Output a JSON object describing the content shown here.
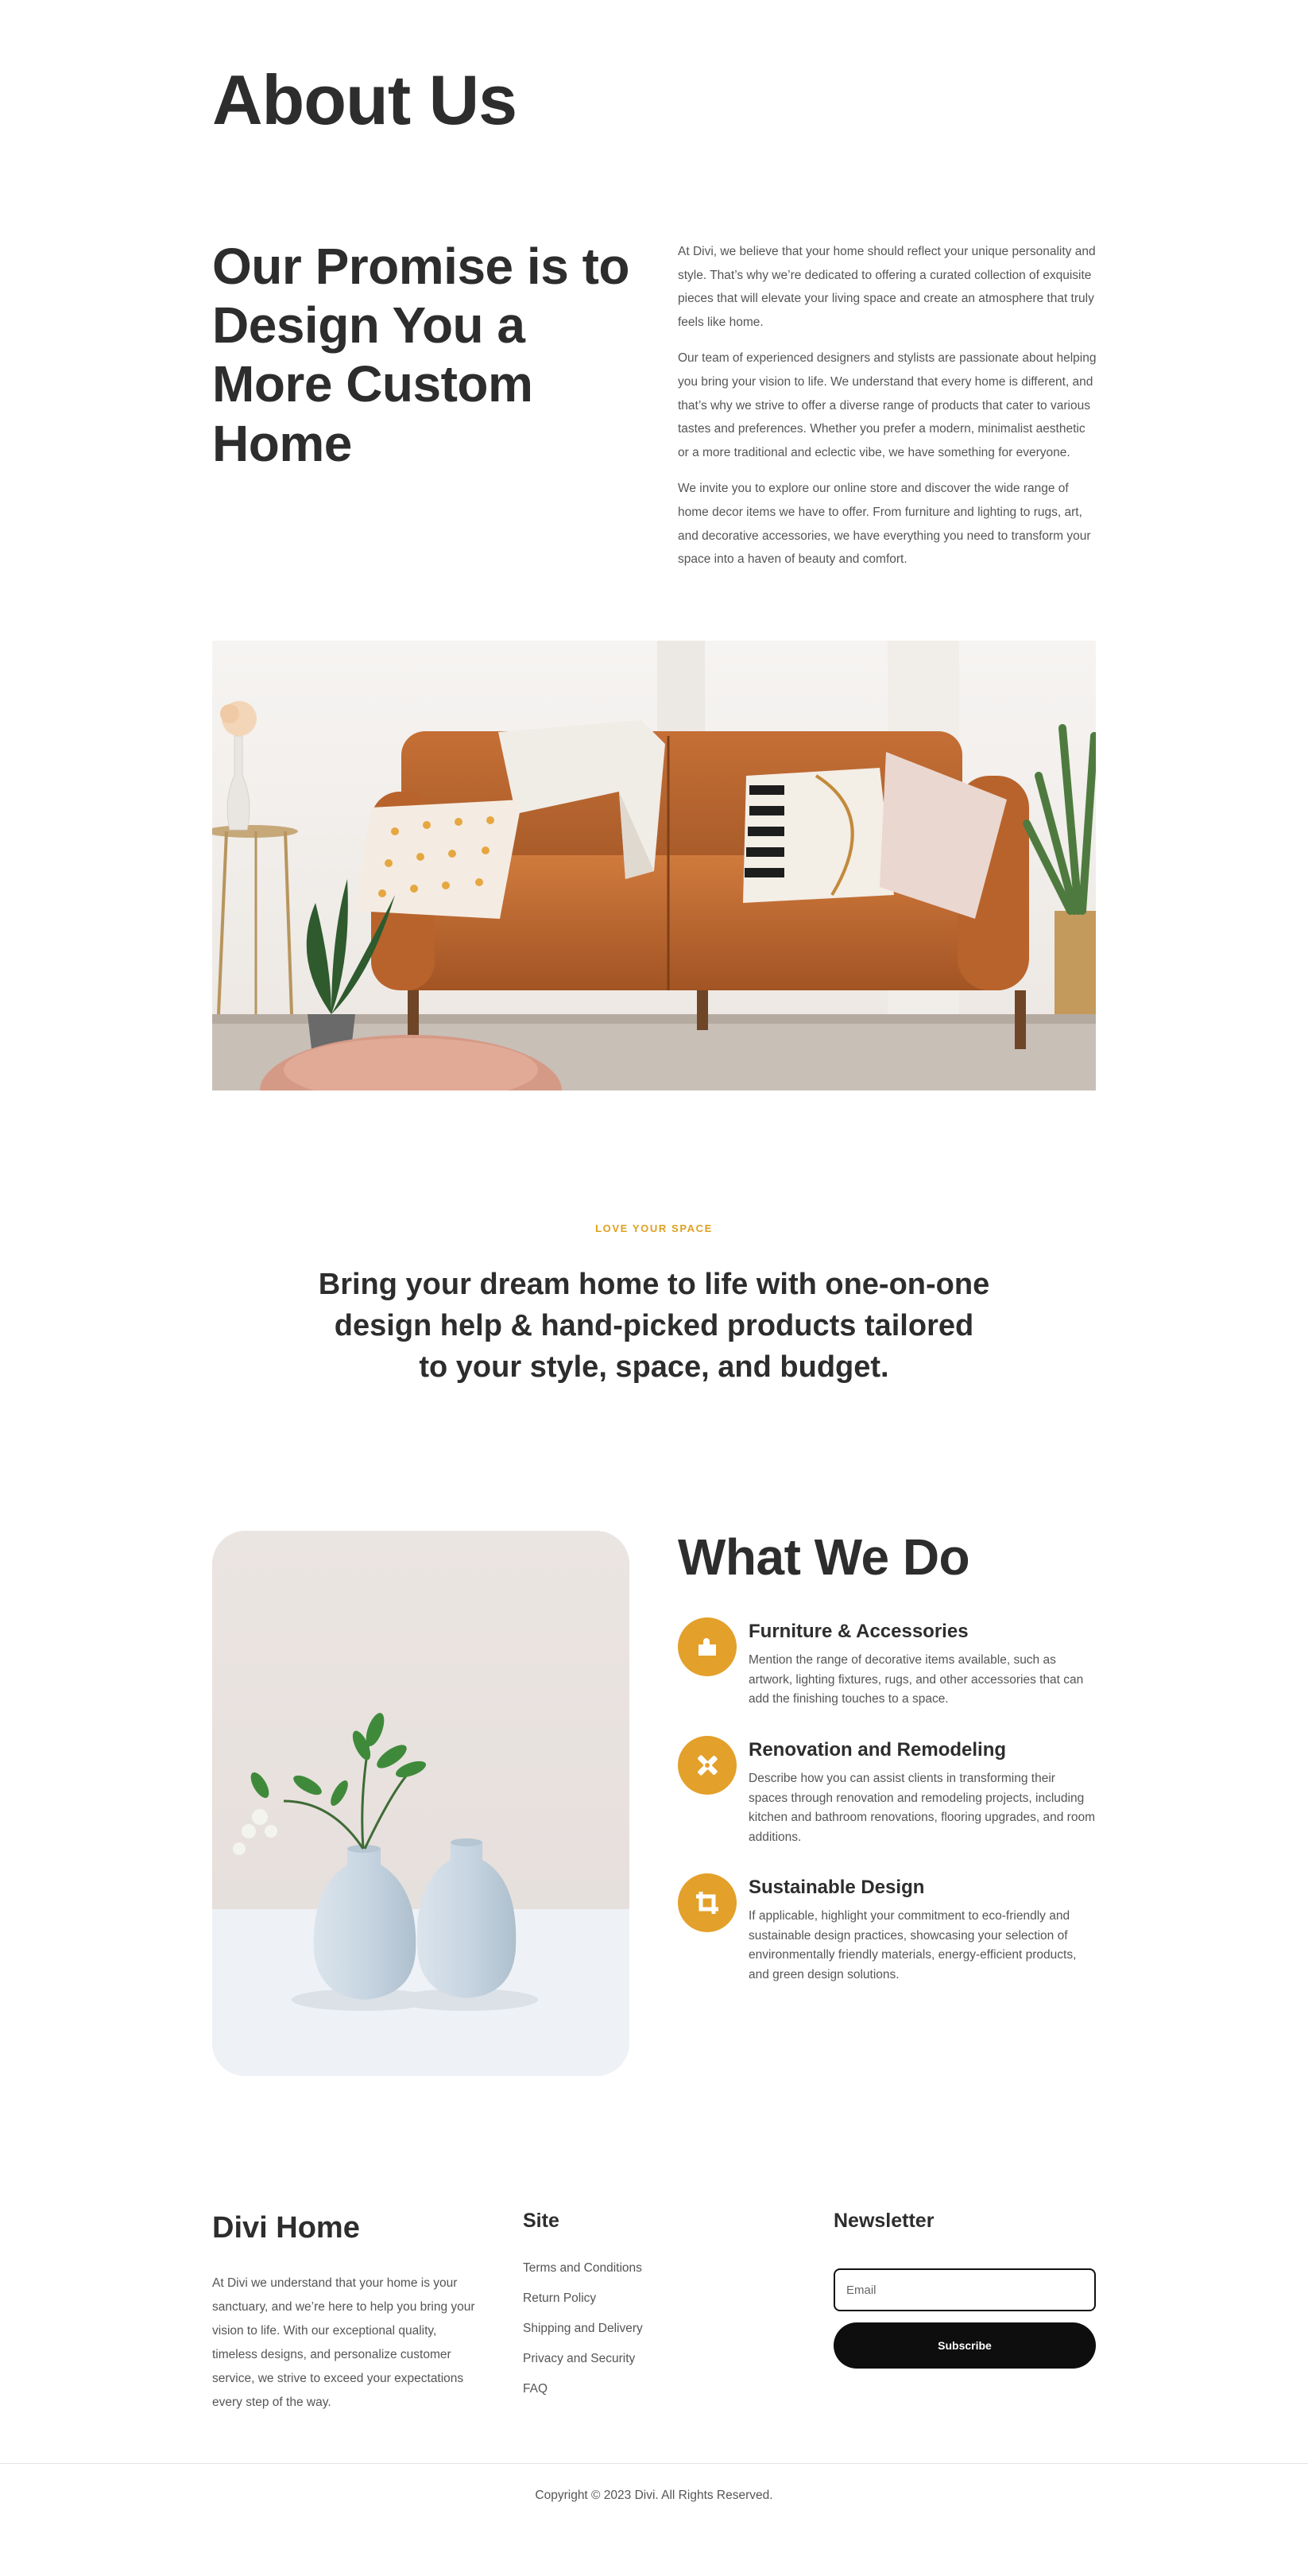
{
  "page": {
    "title": "About Us"
  },
  "promise": {
    "heading": "Our Promise is to Design You a More Custom Home",
    "paragraphs": [
      "At Divi, we believe that your home should reflect your unique personality and style. That’s why we’re dedicated to offering a curated collection of exquisite pieces that will elevate your living space and create an atmosphere that truly feels like home.",
      "Our team of experienced designers and stylists are passionate about helping you bring your vision to life. We understand that every home is different, and that’s why we strive to offer a diverse range of products that cater to various tastes and preferences. Whether you prefer a modern, minimalist aesthetic or a more traditional and eclectic vibe, we have something for everyone.",
      "We invite you to explore our online store and discover the wide range of home decor items we have to offer. From furniture and lighting to rugs, art, and decorative accessories, we have everything you need to transform your space into a haven of beauty and comfort."
    ]
  },
  "cta": {
    "eyebrow": "LOVE YOUR SPACE",
    "tagline": "Bring your dream home to life with one-on-one design help & hand-picked products tailored to your style, space, and budget."
  },
  "services": {
    "heading": "What We Do",
    "items": [
      {
        "icon": "puzzle-icon",
        "title": "Furniture & Accessories",
        "description": "Mention the range of decorative items available, such as artwork, lighting fixtures, rugs, and other accessories that can add the finishing touches to a space."
      },
      {
        "icon": "tools-icon",
        "title": "Renovation and Remodeling",
        "description": "Describe how you can assist clients in transforming their spaces through renovation and remodeling projects, including kitchen and bathroom renovations, flooring upgrades, and room additions."
      },
      {
        "icon": "crop-icon",
        "title": "Sustainable Design",
        "description": "If applicable, highlight your commitment to eco-friendly and sustainable design practices, showcasing your selection of environmentally friendly materials, energy-efficient products, and green design solutions."
      }
    ]
  },
  "footer": {
    "brand": "Divi Home",
    "about": "At Divi we understand that your home is your sanctuary, and we’re here to help you bring your vision to life. With our exceptional quality, timeless designs, and personalize customer service, we strive to exceed your expectations every step of the way.",
    "site_title": "Site",
    "site_links": [
      "Terms and Conditions",
      "Return Policy",
      "Shipping and Delivery",
      "Privacy and Security",
      "FAQ"
    ],
    "newsletter_title": "Newsletter",
    "email_placeholder": "Email",
    "subscribe_label": "Subscribe",
    "copyright": "Copyright © 2023 Divi. All Rights Reserved."
  },
  "colors": {
    "accent": "#e3a02a",
    "text_dark": "#2d2d2d",
    "text_body": "#555555",
    "button": "#0e0e0e"
  }
}
